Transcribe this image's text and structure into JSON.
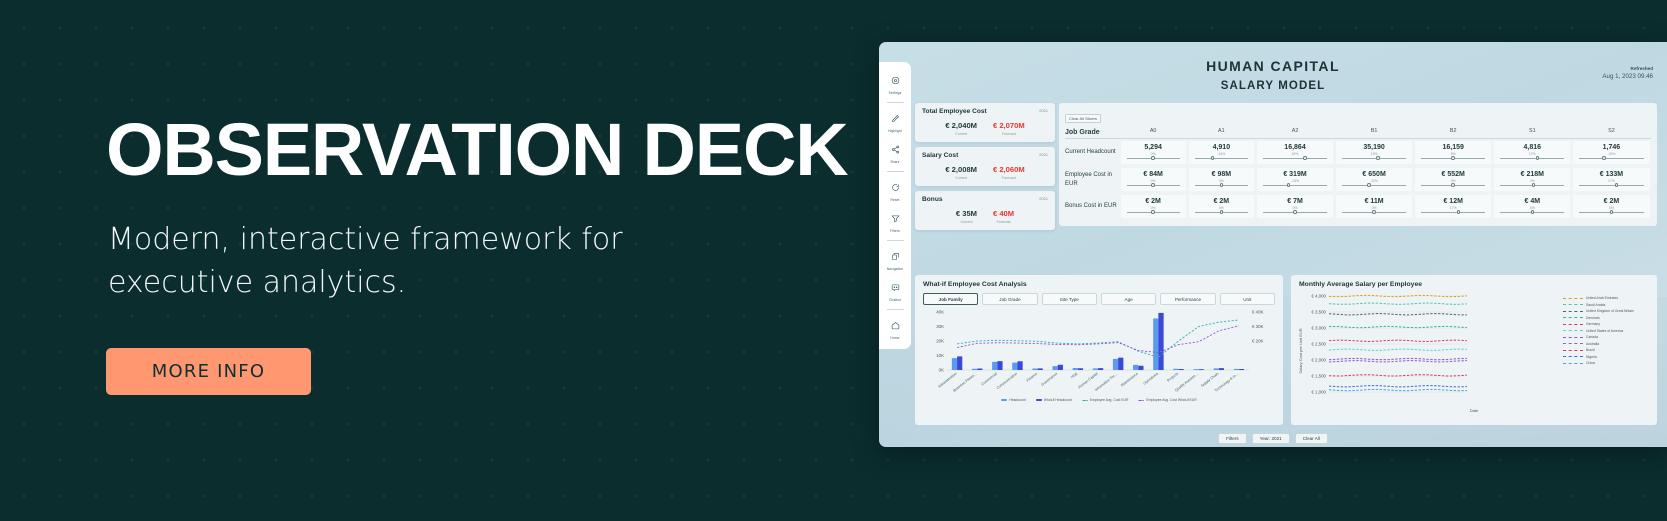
{
  "hero": {
    "title": "OBSERVATION DECK",
    "subtitle": "Modern, interactive framework for executive analytics.",
    "cta_label": "MORE INFO",
    "bg_color": "#0b2d2e",
    "cta_color": "#ff9771"
  },
  "dashboard": {
    "title_line1": "HUMAN CAPITAL",
    "title_line2": "SALARY MODEL",
    "refreshed_label": "Refreshed",
    "refreshed_value": "Aug 1, 2023 09.46",
    "rail": [
      {
        "label": "Settings",
        "icon": "gear-icon"
      },
      {
        "label": "Highlight",
        "icon": "pencil-icon"
      },
      {
        "label": "Share",
        "icon": "share-icon"
      },
      {
        "label": "Reset",
        "icon": "reset-icon"
      },
      {
        "label": "Filters",
        "icon": "filter-icon"
      },
      {
        "label": "Navigation",
        "icon": "copy-icon"
      },
      {
        "label": "Chatbot",
        "icon": "chat-icon"
      },
      {
        "label": "Home",
        "icon": "home-icon"
      }
    ],
    "kpis": [
      {
        "name": "Total Employee Cost",
        "year": "2021",
        "current": "€ 2,040M",
        "forecast": "€ 2,070M",
        "current_caption": "Current",
        "forecast_caption": "Forecast"
      },
      {
        "name": "Salary Cost",
        "year": "2021",
        "current": "€ 2,008M",
        "forecast": "€ 2,060M",
        "current_caption": "Current",
        "forecast_caption": "Forecast"
      },
      {
        "name": "Bonus",
        "year": "2021",
        "current": "€ 35M",
        "forecast": "€ 40M",
        "current_caption": "Current",
        "forecast_caption": "Forecast"
      }
    ],
    "matrix": {
      "clear_slicers": "Clear All Slicers",
      "row_header": "Job Grade",
      "columns": [
        "A0",
        "A1",
        "A2",
        "B1",
        "B2",
        "S1",
        "S2"
      ],
      "rows": [
        {
          "label": "Current Headcount",
          "values": [
            "5,294",
            "4,910",
            "16,864",
            "35,190",
            "16,159",
            "4,816",
            "1,746"
          ],
          "percents": [
            "0%",
            "-34%",
            "45%",
            "15%",
            "8%",
            "17%",
            "-25%"
          ],
          "knobs": [
            50,
            33,
            66,
            56,
            50,
            58,
            38
          ]
        },
        {
          "label": "Employee Cost in EUR",
          "values": [
            "€ 84M",
            "€ 98M",
            "€ 319M",
            "€ 650M",
            "€ 552M",
            "€ 218M",
            "€ 133M"
          ],
          "percents": [
            "0%",
            "0%",
            "-13%",
            "-11%",
            "0%",
            "2%",
            "17%"
          ],
          "knobs": [
            50,
            50,
            40,
            42,
            50,
            52,
            58
          ]
        },
        {
          "label": "Bonus Cost in EUR",
          "values": [
            "€ 2M",
            "€ 2M",
            "€ 7M",
            "€ 11M",
            "€ 12M",
            "€ 4M",
            "€ 2M"
          ],
          "percents": [
            "0%",
            "0%",
            "0%",
            "0%",
            "17%",
            "0%",
            "0%"
          ],
          "knobs": [
            50,
            50,
            50,
            50,
            58,
            50,
            50
          ]
        }
      ]
    },
    "footer_buttons": [
      "Filters",
      "Year: 2021",
      "Clear All"
    ]
  },
  "chart_data": [
    {
      "type": "bar",
      "title": "What-if Employee Cost Analysis",
      "tabs": [
        "Job Family",
        "Job Grade",
        "Site Type",
        "Age",
        "Performance",
        "Unit"
      ],
      "active_tab": "Job Family",
      "xlabel": "",
      "ylabel": "",
      "ylim": [
        0,
        40000
      ],
      "yticks": [
        "0K",
        "10K",
        "20K",
        "30K",
        "40K"
      ],
      "y2ticks": [
        "€ 20K",
        "€ 30K",
        "€ 40K"
      ],
      "categories": [
        "Administration",
        "Business Planning & …",
        "Commercial",
        "Communication",
        "Finance",
        "Governance",
        "HSE",
        "Human Capital",
        "Information Technology",
        "Maintenance",
        "Operations",
        "Projects",
        "Quality Assurance & Q…",
        "Supply Chain",
        "Technology & Innovati…"
      ],
      "series": [
        {
          "name": "Headcount",
          "kind": "bar",
          "color": "#5a9bf0",
          "values": [
            8200,
            900,
            5600,
            5100,
            1000,
            2700,
            1400,
            1100,
            7700,
            3500,
            35500,
            900,
            600,
            1100,
            800
          ]
        },
        {
          "name": "What-if Headcount",
          "kind": "bar",
          "color": "#3b49d6",
          "values": [
            9400,
            1000,
            6100,
            6000,
            1100,
            3600,
            1200,
            1300,
            8500,
            2900,
            39400,
            700,
            600,
            1300,
            700
          ]
        },
        {
          "name": "Employee Avg. Cost EUR",
          "kind": "line-dashed",
          "color": "#2fb5a8",
          "values": [
            18000,
            20000,
            20500,
            20200,
            19800,
            18500,
            18000,
            18600,
            19500,
            13000,
            8800,
            20000,
            30000,
            33000,
            34500
          ]
        },
        {
          "name": "Employee Avg. Cost What-if EUR",
          "kind": "line-dashed",
          "color": "#9b59d0",
          "values": [
            15500,
            18400,
            18800,
            18600,
            18200,
            17600,
            17400,
            18000,
            18900,
            13500,
            12000,
            17500,
            19500,
            27000,
            30500
          ]
        }
      ],
      "legend": [
        "Headcount",
        "What-if Headcount",
        "Employee Avg. Cost EUR",
        "Employee Avg. Cost What-if EUR"
      ],
      "legend_position": "bottom"
    },
    {
      "type": "line",
      "title": "Monthly Average Salary per Employee",
      "xlabel": "Date",
      "ylabel": "Salary Cost per Unit EUR",
      "ylim": [
        1000,
        4000
      ],
      "yticks": [
        "€ 1,000",
        "€ 1,500",
        "€ 2,000",
        "€ 2,500",
        "€ 3,000",
        "€ 3,500",
        "€ 4,000"
      ],
      "grid": true,
      "legend_position": "right",
      "series": [
        {
          "name": "United Arab Emirates",
          "color": "#d6a419",
          "value": 4000
        },
        {
          "name": "Saudi Arabia",
          "color": "#4ec3b8",
          "value": 3760
        },
        {
          "name": "United Kingdom of Great Britain",
          "color": "#55616b",
          "value": 3430
        },
        {
          "name": "Denmark",
          "color": "#2fb5a8",
          "value": 3030
        },
        {
          "name": "Germany",
          "color": "#e0365f",
          "value": 2600
        },
        {
          "name": "United States of America",
          "color": "#5fd3c7",
          "value": 2320
        },
        {
          "name": "Canada",
          "color": "#8b5bd6",
          "value": 2030
        },
        {
          "name": "Australia",
          "color": "#9b59d0",
          "value": 1960
        },
        {
          "name": "Brazil",
          "color": "#e0365f",
          "value": 1520
        },
        {
          "name": "Nigeria",
          "color": "#3b6fd6",
          "value": 1180
        },
        {
          "name": "China",
          "color": "#4ea3e0",
          "value": 1060
        }
      ]
    }
  ]
}
